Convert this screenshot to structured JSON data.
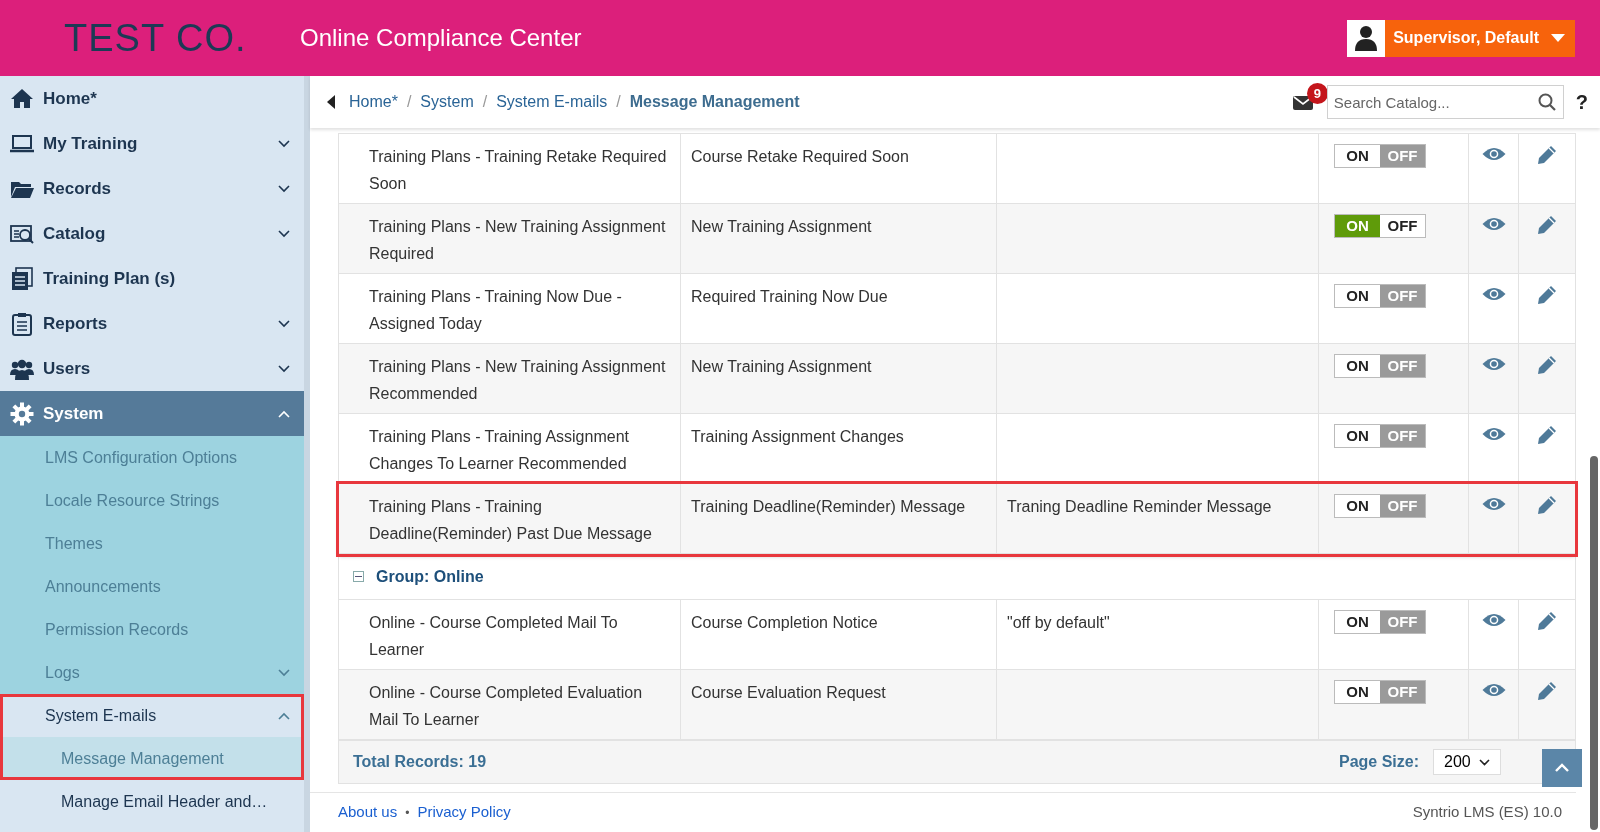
{
  "header": {
    "logo": "TEST CO.",
    "title": "Online Compliance Center",
    "user": "Supervisor, Default"
  },
  "sidebar": {
    "items": [
      {
        "label": "Home*",
        "selected": false
      },
      {
        "label": "My Training",
        "expanded": false,
        "selected": false
      },
      {
        "label": "Records",
        "expanded": false,
        "selected": false
      },
      {
        "label": "Catalog",
        "expanded": false,
        "selected": false
      },
      {
        "label": "Training Plan (s)",
        "selected": false
      },
      {
        "label": "Reports",
        "expanded": false,
        "selected": false
      },
      {
        "label": "Users",
        "expanded": false,
        "selected": false
      },
      {
        "label": "System",
        "expanded": true,
        "selected": true,
        "children": [
          {
            "label": "LMS Configuration Options",
            "highlighted": false
          },
          {
            "label": "Locale Resource Strings",
            "highlighted": false
          },
          {
            "label": "Themes",
            "highlighted": false
          },
          {
            "label": "Announcements",
            "highlighted": false
          },
          {
            "label": "Permission Records",
            "highlighted": false
          },
          {
            "label": "Logs",
            "expanded": false,
            "highlighted": false
          },
          {
            "label": "System E-mails",
            "expanded": true,
            "highlighted": true,
            "children": [
              {
                "label": "Message Management",
                "selected": true
              },
              {
                "label": "Manage Email Header and…",
                "selected": false
              }
            ]
          }
        ]
      }
    ]
  },
  "breadcrumb": {
    "items": [
      {
        "label": "Home*",
        "separator": "/"
      },
      {
        "label": "System",
        "separator": "/"
      },
      {
        "label": "System E-mails",
        "separator": "/"
      }
    ],
    "current": "Message Management"
  },
  "mail_count": "9",
  "search": {
    "placeholder": "Search Catalog..."
  },
  "help": "?",
  "table": {
    "rows": [
      {
        "kind": "message",
        "name": "Training Plans - Training Retake Required Soon",
        "subject": "Course Retake Required Soon",
        "on_label": "ON",
        "off_label": "OFF",
        "on": false,
        "highlighted": false
      },
      {
        "kind": "message",
        "name": "Training Plans - New Training Assignment Required",
        "subject": "New Training Assignment",
        "on_label": "ON",
        "off_label": "OFF",
        "on": true,
        "highlighted": false
      },
      {
        "kind": "message",
        "name": "Training Plans - Training Now Due - Assigned Today",
        "subject": "Required Training Now Due",
        "on_label": "ON",
        "off_label": "OFF",
        "on": false,
        "highlighted": false
      },
      {
        "kind": "message",
        "name": "Training Plans - New Training Assignment Recommended",
        "subject": "New Training Assignment",
        "on_label": "ON",
        "off_label": "OFF",
        "on": false,
        "highlighted": false
      },
      {
        "kind": "message",
        "name": "Training Plans - Training Assignment Changes To Learner Recommended",
        "subject": "Training Assignment Changes",
        "on_label": "ON",
        "off_label": "OFF",
        "on": false,
        "highlighted": false
      },
      {
        "kind": "message",
        "name": "Training Plans - Training Deadline(Reminder) Past Due Message",
        "subject": "Training Deadline(Reminder) Message",
        "description": "Traning Deadline Reminder Message",
        "on_label": "ON",
        "off_label": "OFF",
        "on": false,
        "highlighted": true
      },
      {
        "kind": "group",
        "label": "Group: Online",
        "expanded": true
      },
      {
        "kind": "message",
        "name": "Online - Course Completed Mail To Learner",
        "subject": "Course Completion Notice",
        "description": "\"off by default\"",
        "on_label": "ON",
        "off_label": "OFF",
        "on": false,
        "highlighted": false
      },
      {
        "kind": "message",
        "name": "Online - Course Completed Evaluation Mail To Learner",
        "subject": "Course Evaluation Request",
        "on_label": "ON",
        "off_label": "OFF",
        "on": false,
        "highlighted": false
      }
    ],
    "total": "Total Records: 19",
    "page_size_label": "Page Size:",
    "page_size": "200"
  },
  "footer": {
    "links": [
      "About us",
      "Privacy Policy"
    ],
    "separator": "•",
    "version": "Syntrio LMS (ES) 10.0"
  }
}
